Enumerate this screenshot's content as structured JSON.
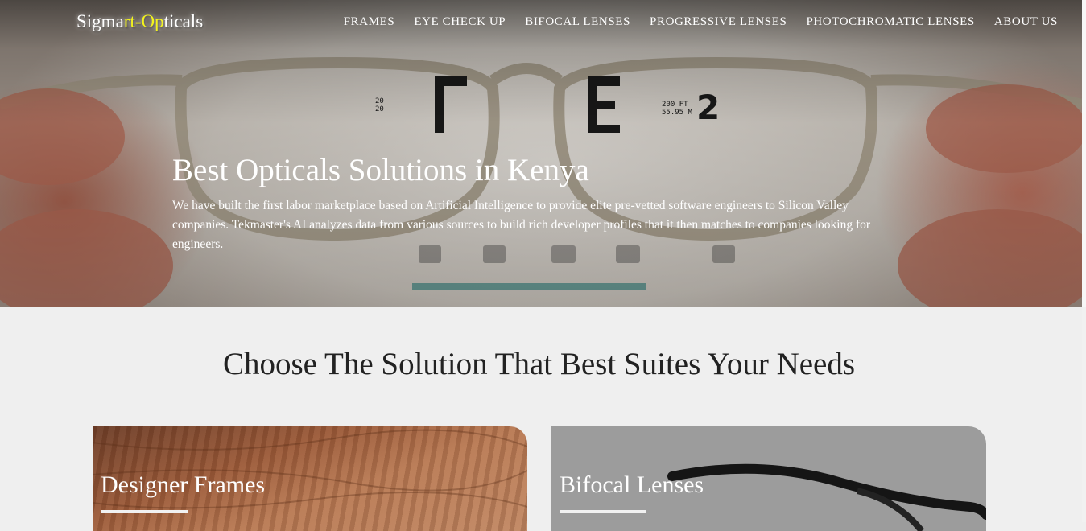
{
  "brand": {
    "logo_parts": [
      "Sigma",
      "rt-Op",
      "ticals"
    ],
    "highlight_color": "#f4f41c"
  },
  "nav": {
    "items": [
      "FRAMES",
      "EYE CHECK UP",
      "BIFOCAL LENSES",
      "PROGRESSIVE LENSES",
      "PHOTOCHROMATIC LENSES",
      "ABOUT US"
    ]
  },
  "hero": {
    "title": "Best Opticals Solutions in Kenya",
    "description": "We have built the first labor marketplace based on Artificial Intelligence to provide elite pre-vetted software engineers to Silicon Valley companies. Tekmaster's AI analyzes data from various sources to build rich developer profiles that it then matches to companies looking for engineers."
  },
  "solutions": {
    "title": "Choose The Solution That Best Suites Your Needs",
    "cards": [
      {
        "title": "Designer Frames"
      },
      {
        "title": "Bifocal Lenses"
      }
    ]
  }
}
